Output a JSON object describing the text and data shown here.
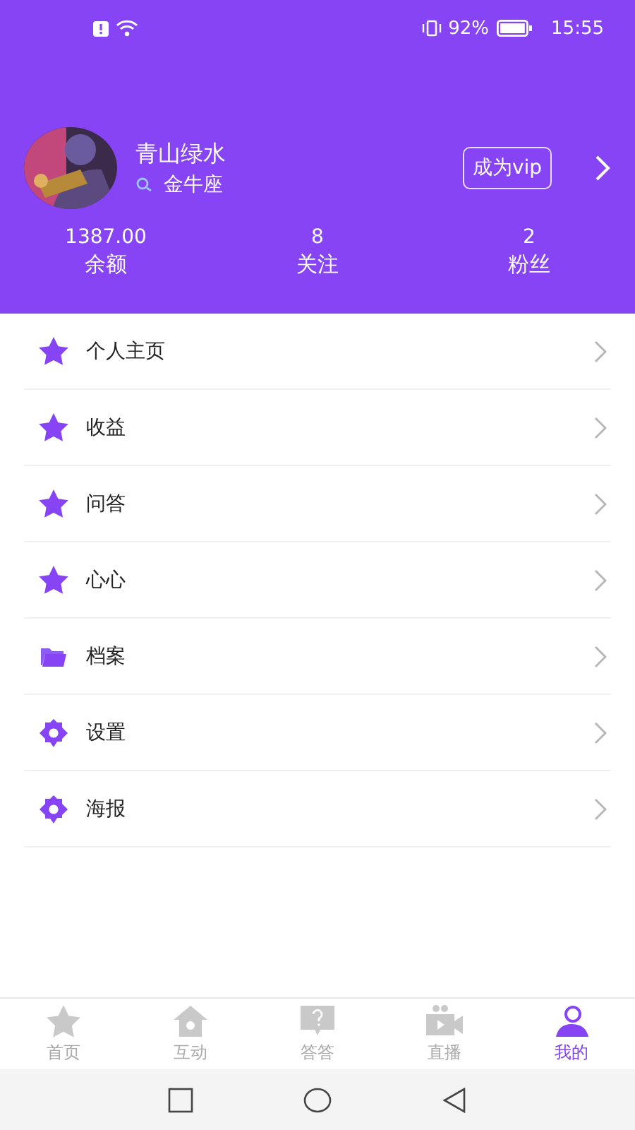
{
  "status_bar": {
    "battery": "92%",
    "time": "15:55"
  },
  "profile": {
    "name": "青山绿水",
    "sign": "金牛座",
    "vip_button": "成为vip"
  },
  "stats": [
    {
      "value": "1387.00",
      "label": "余额"
    },
    {
      "value": "8",
      "label": "关注"
    },
    {
      "value": "2",
      "label": "粉丝"
    }
  ],
  "menu": [
    {
      "label": "个人主页",
      "kind": "star"
    },
    {
      "label": "收益",
      "kind": "star"
    },
    {
      "label": "问答",
      "kind": "star"
    },
    {
      "label": "心心",
      "kind": "star"
    },
    {
      "label": "档案",
      "kind": "folder"
    },
    {
      "label": "设置",
      "kind": "gear"
    },
    {
      "label": "海报",
      "kind": "gear"
    }
  ],
  "tabs": [
    {
      "label": "首页",
      "kind": "star",
      "selected": false
    },
    {
      "label": "互动",
      "kind": "home",
      "selected": false
    },
    {
      "label": "答答",
      "kind": "question",
      "selected": false
    },
    {
      "label": "直播",
      "kind": "video",
      "selected": false
    },
    {
      "label": "我的",
      "kind": "person",
      "selected": true
    }
  ]
}
